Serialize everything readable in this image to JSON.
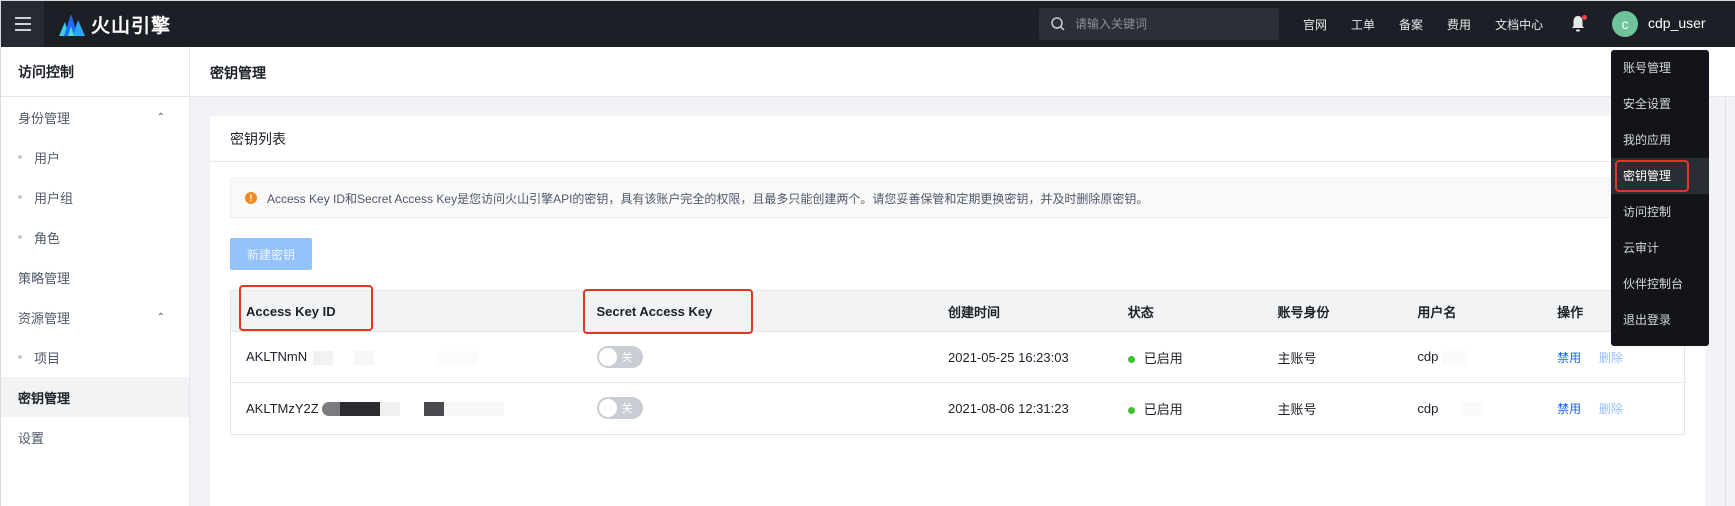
{
  "topbar": {
    "brand": "火山引擎",
    "search_placeholder": "请输入关键词",
    "links": [
      "官网",
      "工单",
      "备案",
      "费用",
      "文档中心"
    ],
    "avatar_initial": "c",
    "username": "cdp_user",
    "notification_dot": true
  },
  "sidebar": {
    "title": "访问控制",
    "groups": [
      {
        "label": "身份管理",
        "expanded": true,
        "children": [
          "用户",
          "用户组",
          "角色"
        ]
      },
      {
        "label": "策略管理"
      },
      {
        "label": "资源管理",
        "expanded": true,
        "children": [
          "项目"
        ]
      },
      {
        "label": "密钥管理",
        "active": true
      },
      {
        "label": "设置"
      }
    ]
  },
  "page": {
    "title": "密钥管理",
    "card_title": "密钥列表",
    "alert": "Access Key ID和Secret Access Key是您访问火山引擎API的密钥，具有该账户完全的权限，且最多只能创建两个。请您妥善保管和定期更换密钥，并及时删除原密钥。",
    "new_key_button": "新建密钥"
  },
  "table": {
    "columns": [
      "Access Key ID",
      "Secret Access Key",
      "创建时间",
      "状态",
      "账号身份",
      "用户名",
      "操作"
    ],
    "rows": [
      {
        "access_key_id": "AKLTNmN",
        "secret_toggle": "关",
        "created": "2021-05-25 16:23:03",
        "status": "已启用",
        "identity": "主账号",
        "username": "cdp",
        "actions": [
          "禁用",
          "删除"
        ]
      },
      {
        "access_key_id": "AKLTMzY2Z",
        "secret_toggle": "关",
        "created": "2021-08-06 12:31:23",
        "status": "已启用",
        "identity": "主账号",
        "username": "cdp",
        "actions": [
          "禁用",
          "删除"
        ]
      }
    ]
  },
  "user_menu": {
    "items": [
      "账号管理",
      "安全设置",
      "我的应用",
      "密钥管理",
      "访问控制",
      "云审计",
      "伙伴控制台",
      "退出登录"
    ],
    "active": "密钥管理"
  },
  "colors": {
    "topbar": "#1c1f26",
    "primary": "#1664ff",
    "status_green": "#3ec233",
    "alert_orange": "#f58a1f",
    "highlight_red": "#e33426",
    "avatar": "#6fc39b"
  }
}
